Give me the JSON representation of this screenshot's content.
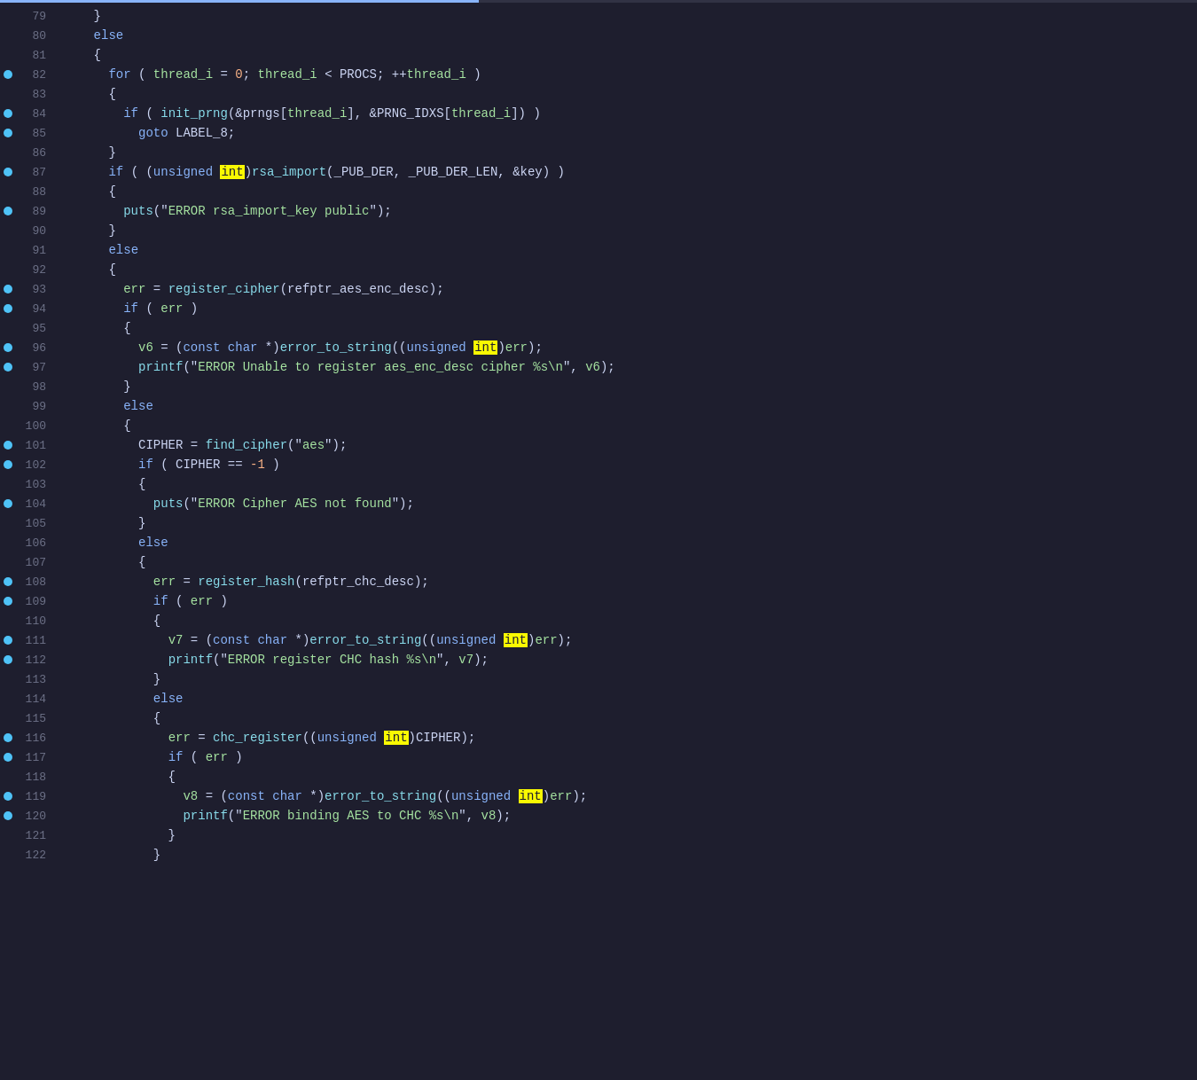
{
  "title": "Code Editor - Code View",
  "accent_color": "#89b4fa",
  "breakpoint_color": "#4fc3f7",
  "highlight_color": "#f9f902",
  "lines": [
    {
      "number": 79,
      "breakpoint": false,
      "tokens": [
        {
          "text": "    }",
          "class": "punct"
        }
      ]
    },
    {
      "number": 80,
      "breakpoint": false,
      "tokens": [
        {
          "text": "    ",
          "class": "plain"
        },
        {
          "text": "else",
          "class": "kw"
        }
      ]
    },
    {
      "number": 81,
      "breakpoint": false,
      "tokens": [
        {
          "text": "    {",
          "class": "punct"
        }
      ]
    },
    {
      "number": 82,
      "breakpoint": true,
      "tokens": [
        {
          "text": "      ",
          "class": "plain"
        },
        {
          "text": "for",
          "class": "kw"
        },
        {
          "text": " ( ",
          "class": "plain"
        },
        {
          "text": "thread_i",
          "class": "green-var"
        },
        {
          "text": " = ",
          "class": "plain"
        },
        {
          "text": "0",
          "class": "num"
        },
        {
          "text": "; ",
          "class": "plain"
        },
        {
          "text": "thread_i",
          "class": "green-var"
        },
        {
          "text": " < ",
          "class": "plain"
        },
        {
          "text": "PROCS",
          "class": "plain"
        },
        {
          "text": "; ++",
          "class": "plain"
        },
        {
          "text": "thread_i",
          "class": "green-var"
        },
        {
          "text": " )",
          "class": "plain"
        }
      ]
    },
    {
      "number": 83,
      "breakpoint": false,
      "tokens": [
        {
          "text": "      {",
          "class": "punct"
        }
      ]
    },
    {
      "number": 84,
      "breakpoint": true,
      "tokens": [
        {
          "text": "        ",
          "class": "plain"
        },
        {
          "text": "if",
          "class": "kw"
        },
        {
          "text": " ( ",
          "class": "plain"
        },
        {
          "text": "init_prng",
          "class": "cyan-fn"
        },
        {
          "text": "(&",
          "class": "plain"
        },
        {
          "text": "prngs",
          "class": "plain"
        },
        {
          "text": "[",
          "class": "plain"
        },
        {
          "text": "thread_i",
          "class": "green-var"
        },
        {
          "text": "], &",
          "class": "plain"
        },
        {
          "text": "PRNG_IDXS",
          "class": "plain"
        },
        {
          "text": "[",
          "class": "plain"
        },
        {
          "text": "thread_i",
          "class": "green-var"
        },
        {
          "text": "]) )",
          "class": "plain"
        }
      ]
    },
    {
      "number": 85,
      "breakpoint": true,
      "tokens": [
        {
          "text": "          ",
          "class": "plain"
        },
        {
          "text": "goto",
          "class": "kw"
        },
        {
          "text": " LABEL_8;",
          "class": "plain"
        }
      ]
    },
    {
      "number": 86,
      "breakpoint": false,
      "tokens": [
        {
          "text": "      }",
          "class": "punct"
        }
      ]
    },
    {
      "number": 87,
      "breakpoint": true,
      "tokens": [
        {
          "text": "      ",
          "class": "plain"
        },
        {
          "text": "if",
          "class": "kw"
        },
        {
          "text": " ( (",
          "class": "plain"
        },
        {
          "text": "unsigned",
          "class": "kw"
        },
        {
          "text": " ",
          "class": "plain"
        },
        {
          "text": "int",
          "class": "highlight"
        },
        {
          "text": ")",
          "class": "plain"
        },
        {
          "text": "rsa_import",
          "class": "cyan-fn"
        },
        {
          "text": "(_PUB_DER, _PUB_DER_LEN, &",
          "class": "plain"
        },
        {
          "text": "key",
          "class": "plain"
        },
        {
          "text": ") )",
          "class": "plain"
        }
      ]
    },
    {
      "number": 88,
      "breakpoint": false,
      "tokens": [
        {
          "text": "      {",
          "class": "punct"
        }
      ]
    },
    {
      "number": 89,
      "breakpoint": true,
      "tokens": [
        {
          "text": "        ",
          "class": "plain"
        },
        {
          "text": "puts",
          "class": "cyan-fn"
        },
        {
          "text": "(\"",
          "class": "plain"
        },
        {
          "text": "ERROR rsa_import_key public",
          "class": "str"
        },
        {
          "text": "\");",
          "class": "plain"
        }
      ]
    },
    {
      "number": 90,
      "breakpoint": false,
      "tokens": [
        {
          "text": "      }",
          "class": "punct"
        }
      ]
    },
    {
      "number": 91,
      "breakpoint": false,
      "tokens": [
        {
          "text": "      ",
          "class": "plain"
        },
        {
          "text": "else",
          "class": "kw"
        }
      ]
    },
    {
      "number": 92,
      "breakpoint": false,
      "tokens": [
        {
          "text": "      {",
          "class": "punct"
        }
      ]
    },
    {
      "number": 93,
      "breakpoint": true,
      "tokens": [
        {
          "text": "        ",
          "class": "plain"
        },
        {
          "text": "err",
          "class": "green-var"
        },
        {
          "text": " = ",
          "class": "plain"
        },
        {
          "text": "register_cipher",
          "class": "cyan-fn"
        },
        {
          "text": "(",
          "class": "plain"
        },
        {
          "text": "refptr_aes_enc_desc",
          "class": "plain"
        },
        {
          "text": ");",
          "class": "plain"
        }
      ]
    },
    {
      "number": 94,
      "breakpoint": true,
      "tokens": [
        {
          "text": "        ",
          "class": "plain"
        },
        {
          "text": "if",
          "class": "kw"
        },
        {
          "text": " ( ",
          "class": "plain"
        },
        {
          "text": "err",
          "class": "green-var"
        },
        {
          "text": " )",
          "class": "plain"
        }
      ]
    },
    {
      "number": 95,
      "breakpoint": false,
      "tokens": [
        {
          "text": "        {",
          "class": "punct"
        }
      ]
    },
    {
      "number": 96,
      "breakpoint": true,
      "tokens": [
        {
          "text": "          ",
          "class": "plain"
        },
        {
          "text": "v6",
          "class": "green-var"
        },
        {
          "text": " = (",
          "class": "plain"
        },
        {
          "text": "const",
          "class": "kw"
        },
        {
          "text": " ",
          "class": "plain"
        },
        {
          "text": "char",
          "class": "kw"
        },
        {
          "text": " *)",
          "class": "plain"
        },
        {
          "text": "error_to_string",
          "class": "cyan-fn"
        },
        {
          "text": "((",
          "class": "plain"
        },
        {
          "text": "unsigned",
          "class": "kw"
        },
        {
          "text": " ",
          "class": "plain"
        },
        {
          "text": "int",
          "class": "highlight"
        },
        {
          "text": ")",
          "class": "plain"
        },
        {
          "text": "err",
          "class": "green-var"
        },
        {
          "text": ");",
          "class": "plain"
        }
      ]
    },
    {
      "number": 97,
      "breakpoint": true,
      "tokens": [
        {
          "text": "          ",
          "class": "plain"
        },
        {
          "text": "printf",
          "class": "cyan-fn"
        },
        {
          "text": "(\"",
          "class": "plain"
        },
        {
          "text": "ERROR Unable to register aes_enc_desc cipher %s\\n",
          "class": "str"
        },
        {
          "text": "\", ",
          "class": "plain"
        },
        {
          "text": "v6",
          "class": "green-var"
        },
        {
          "text": ");",
          "class": "plain"
        }
      ]
    },
    {
      "number": 98,
      "breakpoint": false,
      "tokens": [
        {
          "text": "        }",
          "class": "punct"
        }
      ]
    },
    {
      "number": 99,
      "breakpoint": false,
      "tokens": [
        {
          "text": "        ",
          "class": "plain"
        },
        {
          "text": "else",
          "class": "kw"
        }
      ]
    },
    {
      "number": 100,
      "breakpoint": false,
      "tokens": [
        {
          "text": "        {",
          "class": "punct"
        }
      ]
    },
    {
      "number": 101,
      "breakpoint": true,
      "tokens": [
        {
          "text": "          ",
          "class": "plain"
        },
        {
          "text": "CIPHER",
          "class": "plain"
        },
        {
          "text": " = ",
          "class": "plain"
        },
        {
          "text": "find_cipher",
          "class": "cyan-fn"
        },
        {
          "text": "(\"",
          "class": "plain"
        },
        {
          "text": "aes",
          "class": "str"
        },
        {
          "text": "\");",
          "class": "plain"
        }
      ]
    },
    {
      "number": 102,
      "breakpoint": true,
      "tokens": [
        {
          "text": "          ",
          "class": "plain"
        },
        {
          "text": "if",
          "class": "kw"
        },
        {
          "text": " ( ",
          "class": "plain"
        },
        {
          "text": "CIPHER",
          "class": "plain"
        },
        {
          "text": " == ",
          "class": "plain"
        },
        {
          "text": "-1",
          "class": "num"
        },
        {
          "text": " )",
          "class": "plain"
        }
      ]
    },
    {
      "number": 103,
      "breakpoint": false,
      "tokens": [
        {
          "text": "          {",
          "class": "punct"
        }
      ]
    },
    {
      "number": 104,
      "breakpoint": true,
      "tokens": [
        {
          "text": "            ",
          "class": "plain"
        },
        {
          "text": "puts",
          "class": "cyan-fn"
        },
        {
          "text": "(\"",
          "class": "plain"
        },
        {
          "text": "ERROR Cipher AES not found",
          "class": "str"
        },
        {
          "text": "\");",
          "class": "plain"
        }
      ]
    },
    {
      "number": 105,
      "breakpoint": false,
      "tokens": [
        {
          "text": "          }",
          "class": "punct"
        }
      ]
    },
    {
      "number": 106,
      "breakpoint": false,
      "tokens": [
        {
          "text": "          ",
          "class": "plain"
        },
        {
          "text": "else",
          "class": "kw"
        }
      ]
    },
    {
      "number": 107,
      "breakpoint": false,
      "tokens": [
        {
          "text": "          {",
          "class": "punct"
        }
      ]
    },
    {
      "number": 108,
      "breakpoint": true,
      "tokens": [
        {
          "text": "            ",
          "class": "plain"
        },
        {
          "text": "err",
          "class": "green-var"
        },
        {
          "text": " = ",
          "class": "plain"
        },
        {
          "text": "register_hash",
          "class": "cyan-fn"
        },
        {
          "text": "(",
          "class": "plain"
        },
        {
          "text": "refptr_chc_desc",
          "class": "plain"
        },
        {
          "text": ");",
          "class": "plain"
        }
      ]
    },
    {
      "number": 109,
      "breakpoint": true,
      "tokens": [
        {
          "text": "            ",
          "class": "plain"
        },
        {
          "text": "if",
          "class": "kw"
        },
        {
          "text": " ( ",
          "class": "plain"
        },
        {
          "text": "err",
          "class": "green-var"
        },
        {
          "text": " )",
          "class": "plain"
        }
      ]
    },
    {
      "number": 110,
      "breakpoint": false,
      "tokens": [
        {
          "text": "            {",
          "class": "punct"
        }
      ]
    },
    {
      "number": 111,
      "breakpoint": true,
      "tokens": [
        {
          "text": "              ",
          "class": "plain"
        },
        {
          "text": "v7",
          "class": "green-var"
        },
        {
          "text": " = (",
          "class": "plain"
        },
        {
          "text": "const",
          "class": "kw"
        },
        {
          "text": " ",
          "class": "plain"
        },
        {
          "text": "char",
          "class": "kw"
        },
        {
          "text": " *)",
          "class": "plain"
        },
        {
          "text": "error_to_string",
          "class": "cyan-fn"
        },
        {
          "text": "((",
          "class": "plain"
        },
        {
          "text": "unsigned",
          "class": "kw"
        },
        {
          "text": " ",
          "class": "plain"
        },
        {
          "text": "int",
          "class": "highlight"
        },
        {
          "text": ")",
          "class": "plain"
        },
        {
          "text": "err",
          "class": "green-var"
        },
        {
          "text": ");",
          "class": "plain"
        }
      ]
    },
    {
      "number": 112,
      "breakpoint": true,
      "tokens": [
        {
          "text": "              ",
          "class": "plain"
        },
        {
          "text": "printf",
          "class": "cyan-fn"
        },
        {
          "text": "(\"",
          "class": "plain"
        },
        {
          "text": "ERROR register CHC hash %s\\n",
          "class": "str"
        },
        {
          "text": "\", ",
          "class": "plain"
        },
        {
          "text": "v7",
          "class": "green-var"
        },
        {
          "text": ");",
          "class": "plain"
        }
      ]
    },
    {
      "number": 113,
      "breakpoint": false,
      "tokens": [
        {
          "text": "            }",
          "class": "punct"
        }
      ]
    },
    {
      "number": 114,
      "breakpoint": false,
      "tokens": [
        {
          "text": "            ",
          "class": "plain"
        },
        {
          "text": "else",
          "class": "kw"
        }
      ]
    },
    {
      "number": 115,
      "breakpoint": false,
      "tokens": [
        {
          "text": "            {",
          "class": "punct"
        }
      ]
    },
    {
      "number": 116,
      "breakpoint": true,
      "tokens": [
        {
          "text": "              ",
          "class": "plain"
        },
        {
          "text": "err",
          "class": "green-var"
        },
        {
          "text": " = ",
          "class": "plain"
        },
        {
          "text": "chc_register",
          "class": "cyan-fn"
        },
        {
          "text": "((",
          "class": "plain"
        },
        {
          "text": "unsigned",
          "class": "kw"
        },
        {
          "text": " ",
          "class": "plain"
        },
        {
          "text": "int",
          "class": "highlight"
        },
        {
          "text": ")",
          "class": "plain"
        },
        {
          "text": "CIPHER",
          "class": "plain"
        },
        {
          "text": ");",
          "class": "plain"
        }
      ]
    },
    {
      "number": 117,
      "breakpoint": true,
      "tokens": [
        {
          "text": "              ",
          "class": "plain"
        },
        {
          "text": "if",
          "class": "kw"
        },
        {
          "text": " ( ",
          "class": "plain"
        },
        {
          "text": "err",
          "class": "green-var"
        },
        {
          "text": " )",
          "class": "plain"
        }
      ]
    },
    {
      "number": 118,
      "breakpoint": false,
      "tokens": [
        {
          "text": "              {",
          "class": "punct"
        }
      ]
    },
    {
      "number": 119,
      "breakpoint": true,
      "tokens": [
        {
          "text": "                ",
          "class": "plain"
        },
        {
          "text": "v8",
          "class": "green-var"
        },
        {
          "text": " = (",
          "class": "plain"
        },
        {
          "text": "const",
          "class": "kw"
        },
        {
          "text": " ",
          "class": "plain"
        },
        {
          "text": "char",
          "class": "kw"
        },
        {
          "text": " *)",
          "class": "plain"
        },
        {
          "text": "error_to_string",
          "class": "cyan-fn"
        },
        {
          "text": "((",
          "class": "plain"
        },
        {
          "text": "unsigned",
          "class": "kw"
        },
        {
          "text": " ",
          "class": "plain"
        },
        {
          "text": "int",
          "class": "highlight"
        },
        {
          "text": ")",
          "class": "plain"
        },
        {
          "text": "err",
          "class": "green-var"
        },
        {
          "text": ");",
          "class": "plain"
        }
      ]
    },
    {
      "number": 120,
      "breakpoint": true,
      "tokens": [
        {
          "text": "                ",
          "class": "plain"
        },
        {
          "text": "printf",
          "class": "cyan-fn"
        },
        {
          "text": "(\"",
          "class": "plain"
        },
        {
          "text": "ERROR binding AES ",
          "class": "str"
        },
        {
          "text": "to",
          "class": "str"
        },
        {
          "text": " CHC %s\\n",
          "class": "str"
        },
        {
          "text": "\", ",
          "class": "plain"
        },
        {
          "text": "v8",
          "class": "green-var"
        },
        {
          "text": ");",
          "class": "plain"
        }
      ]
    },
    {
      "number": 121,
      "breakpoint": false,
      "tokens": [
        {
          "text": "              }",
          "class": "punct"
        }
      ]
    },
    {
      "number": 122,
      "breakpoint": false,
      "tokens": [
        {
          "text": "            }",
          "class": "punct"
        }
      ]
    }
  ]
}
